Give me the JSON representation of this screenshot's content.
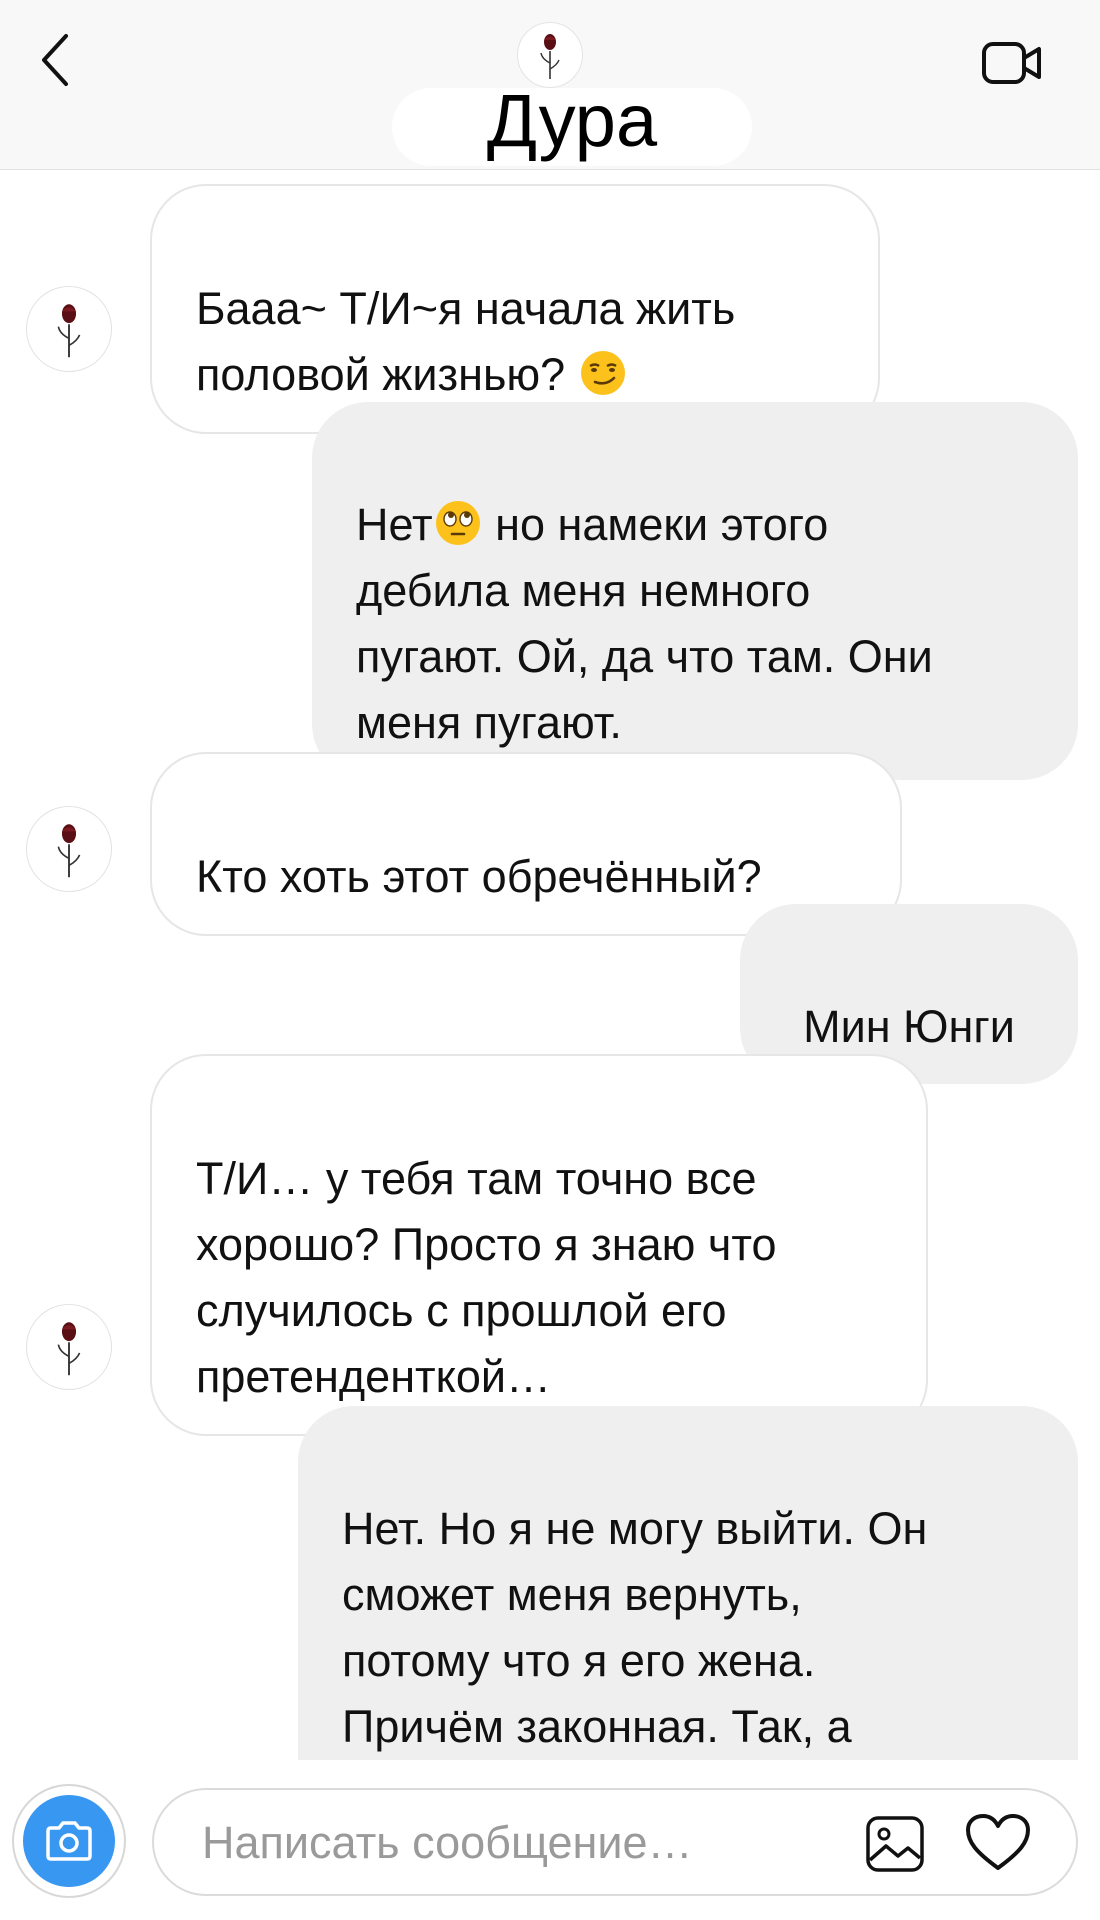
{
  "header": {
    "title": "Дура",
    "back_icon": "chevron-left-icon",
    "video_icon": "video-camera-icon",
    "avatar_icon": "rose-icon"
  },
  "messages": [
    {
      "direction": "incoming",
      "lines": "Бааа~ Т/И~я начала жить\nполовой жизнью? ",
      "emoji": "smirking-face-emoji"
    },
    {
      "direction": "outgoing",
      "lines_before": "Нет",
      "emoji": "eye-roll-face-emoji",
      "lines": " но намеки этого\nдебила меня немного\nпугают. Ой, да что там. Они\nменя пугают."
    },
    {
      "direction": "incoming",
      "lines": "Кто хоть этот обречённый?"
    },
    {
      "direction": "outgoing",
      "lines": "Мин Юнги"
    },
    {
      "direction": "incoming",
      "lines": "Т/И… у тебя там точно все\nхорошо? Просто я знаю что\nслучилось с прошлой его\nпретенденткой…"
    },
    {
      "direction": "outgoing",
      "lines": "Нет. Но я не могу выйти. Он\nсможет меня вернуть,\nпотому что я его жена.\nПричём законная. Так, а\nтеперь просто принеси мне"
    }
  ],
  "composer": {
    "placeholder": "Написать сообщение…",
    "camera_icon": "camera-icon",
    "gallery_icon": "image-gallery-icon",
    "like_icon": "heart-icon",
    "accent_color": "#3897f0"
  }
}
